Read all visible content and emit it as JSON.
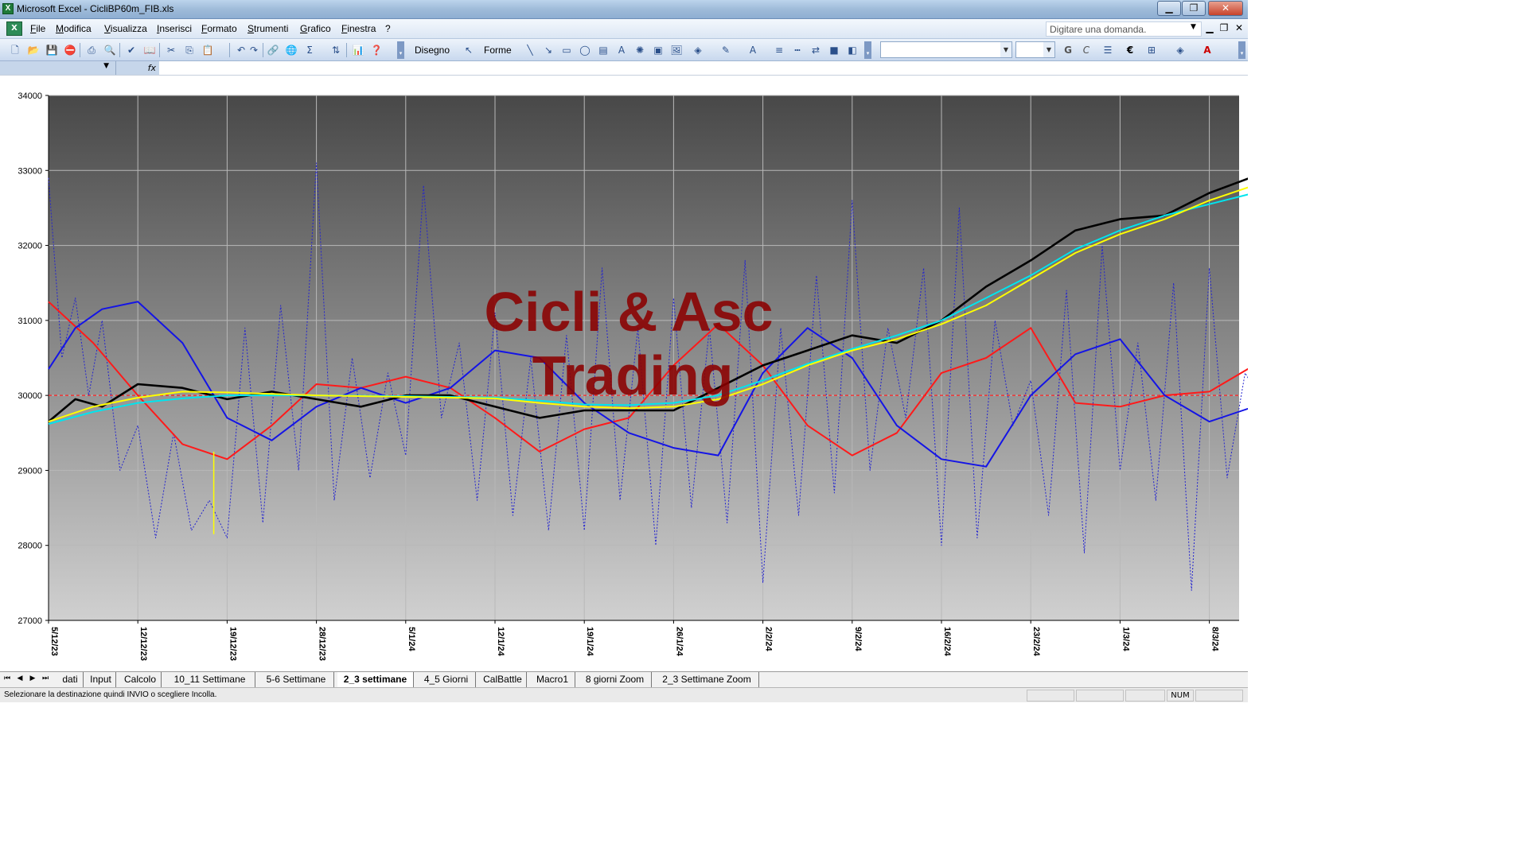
{
  "window": {
    "title": "Microsoft Excel - CicliBP60m_FIB.xls",
    "controls": {
      "minimize": "▁",
      "restore": "❐",
      "close": "✕"
    }
  },
  "menubar": {
    "items": [
      "File",
      "Modifica",
      "Visualizza",
      "Inserisci",
      "Formato",
      "Strumenti",
      "Grafico",
      "Finestra",
      "?"
    ],
    "help_placeholder": "Digitare una domanda.",
    "mdi": {
      "minimize": "▁",
      "restore": "❐",
      "close": "✕"
    }
  },
  "toolbar": {
    "disegno_label": "Disegno",
    "forme_label": "Forme",
    "icons": [
      "new-icon",
      "open-icon",
      "save-icon",
      "permission-icon",
      "print-icon",
      "print-preview-icon",
      "spelling-icon",
      "research-icon",
      "cut-icon",
      "copy-icon",
      "paste-icon",
      "undo-icon",
      "redo-icon",
      "insert-hyperlink-icon",
      "autosum-icon",
      "sort-icon",
      "chart-wizard-icon",
      "help-icon"
    ],
    "bold_label": "G",
    "italic_label": "C",
    "euro_label": "€",
    "font_color_label": "A"
  },
  "formula_bar": {
    "fx_label": "fx"
  },
  "chart_data": {
    "type": "line",
    "ylim": [
      27000,
      34000
    ],
    "yticks": [
      27000,
      28000,
      29000,
      30000,
      31000,
      32000,
      33000,
      34000
    ],
    "xtick_labels": [
      "5/12/23",
      "12/12/23",
      "19/12/23",
      "28/12/23",
      "5/1/24",
      "12/1/24",
      "19/1/24",
      "26/1/24",
      "2/2/24",
      "9/2/24",
      "16/2/24",
      "23/2/24",
      "1/3/24",
      "8/3/24"
    ],
    "reference_line": 30000,
    "watermark": [
      "Cicli & Asc",
      "Trading"
    ],
    "colors": {
      "price": "#000000",
      "yellow": "#ffff00",
      "cyan": "#00e5ee",
      "red": "#ff1a1a",
      "blue": "#1414e6",
      "dotted": "#2323d0",
      "watermark": "#8b0000"
    },
    "series": [
      {
        "key": "price",
        "x": [
          0,
          0.3,
          0.6,
          1,
          1.5,
          2,
          2.5,
          3,
          3.5,
          4,
          4.5,
          5,
          5.5,
          6,
          6.5,
          7,
          7.5,
          8,
          8.5,
          9,
          9.5,
          10,
          10.5,
          11,
          11.5,
          12,
          12.5,
          13,
          13.5,
          13.9
        ],
        "values": [
          29650,
          29950,
          29850,
          30150,
          30100,
          29950,
          30050,
          29950,
          29850,
          30000,
          30000,
          29850,
          29700,
          29800,
          29800,
          29800,
          30100,
          30400,
          30600,
          30800,
          30700,
          31000,
          31450,
          31800,
          32200,
          32350,
          32400,
          32700,
          32920,
          32750
        ]
      },
      {
        "key": "yellow",
        "x": [
          0,
          0.5,
          1,
          1.5,
          2,
          3,
          4,
          5,
          5.5,
          6,
          6.5,
          7,
          7.5,
          8,
          8.5,
          9,
          9.5,
          10,
          10.5,
          11,
          11.5,
          12,
          12.5,
          13,
          13.5,
          13.9
        ],
        "values": [
          29650,
          29850,
          29970,
          30050,
          30040,
          30000,
          29980,
          29960,
          29900,
          29850,
          29830,
          29850,
          29950,
          30150,
          30400,
          30600,
          30750,
          30950,
          31200,
          31550,
          31900,
          32150,
          32350,
          32600,
          32800,
          32900
        ]
      },
      {
        "key": "cyan",
        "x": [
          0,
          0.5,
          1,
          1.5,
          2,
          3,
          4,
          5,
          5.5,
          6,
          6.5,
          7,
          7.5,
          8,
          8.5,
          9,
          9.5,
          10,
          10.5,
          11,
          11.5,
          12,
          12.5,
          13,
          13.5,
          13.9
        ],
        "values": [
          29620,
          29780,
          29900,
          29960,
          30000,
          30000,
          29990,
          29970,
          29930,
          29880,
          29870,
          29900,
          30000,
          30200,
          30420,
          30620,
          30800,
          31000,
          31300,
          31600,
          31950,
          32200,
          32400,
          32550,
          32700,
          32800
        ]
      },
      {
        "key": "red",
        "x": [
          0,
          0.5,
          1,
          1.5,
          2,
          2.5,
          3,
          3.5,
          4,
          4.5,
          5,
          5.5,
          6,
          6.5,
          7,
          7.5,
          8,
          8.5,
          9,
          9.5,
          10,
          10.5,
          11,
          11.5,
          12,
          12.5,
          13,
          13.5,
          13.9
        ],
        "values": [
          31250,
          30700,
          30000,
          29350,
          29150,
          29600,
          30150,
          30100,
          30250,
          30100,
          29700,
          29250,
          29550,
          29700,
          30400,
          30950,
          30400,
          29600,
          29200,
          29500,
          30300,
          30500,
          30900,
          29900,
          29850,
          30000,
          30050,
          30400,
          29950
        ]
      },
      {
        "key": "blue",
        "x": [
          0,
          0.3,
          0.6,
          1,
          1.5,
          2,
          2.5,
          3,
          3.5,
          4,
          4.5,
          5,
          5.5,
          6,
          6.5,
          7,
          7.5,
          8,
          8.5,
          9,
          9.5,
          10,
          10.5,
          11,
          11.5,
          12,
          12.5,
          13,
          13.5,
          13.9
        ],
        "values": [
          30350,
          30900,
          31150,
          31250,
          30700,
          29700,
          29400,
          29850,
          30100,
          29900,
          30100,
          30600,
          30500,
          29900,
          29500,
          29300,
          29200,
          30300,
          30900,
          30500,
          29600,
          29150,
          29050,
          30000,
          30550,
          30750,
          30000,
          29650,
          29850,
          30500
        ]
      },
      {
        "key": "dotted",
        "x": [
          0,
          0.15,
          0.3,
          0.45,
          0.6,
          0.8,
          1,
          1.2,
          1.4,
          1.6,
          1.8,
          2,
          2.2,
          2.4,
          2.6,
          2.8,
          3,
          3.2,
          3.4,
          3.6,
          3.8,
          4,
          4.2,
          4.4,
          4.6,
          4.8,
          5,
          5.2,
          5.4,
          5.6,
          5.8,
          6,
          6.2,
          6.4,
          6.6,
          6.8,
          7,
          7.2,
          7.4,
          7.6,
          7.8,
          8,
          8.2,
          8.4,
          8.6,
          8.8,
          9,
          9.2,
          9.4,
          9.6,
          9.8,
          10,
          10.2,
          10.4,
          10.6,
          10.8,
          11,
          11.2,
          11.4,
          11.6,
          11.8,
          12,
          12.2,
          12.4,
          12.6,
          12.8,
          13,
          13.2,
          13.4,
          13.6,
          13.8,
          13.9
        ],
        "values": [
          32900,
          30500,
          31300,
          30000,
          31000,
          29000,
          29600,
          28100,
          29500,
          28200,
          28600,
          28100,
          30900,
          28300,
          31200,
          29000,
          33100,
          28600,
          30500,
          28900,
          30300,
          29200,
          32800,
          29700,
          30700,
          28600,
          31100,
          28400,
          30500,
          28200,
          30800,
          28200,
          31700,
          28600,
          30900,
          28000,
          31300,
          28500,
          30900,
          28300,
          31800,
          27500,
          30900,
          28400,
          31600,
          28700,
          32600,
          29000,
          30900,
          29700,
          31700,
          28000,
          32500,
          28100,
          31000,
          29600,
          30200,
          28400,
          31400,
          27900,
          32000,
          29000,
          30700,
          28600,
          31500,
          27400,
          31700,
          28900,
          30300,
          29900,
          30000,
          28700
        ]
      },
      {
        "key": "marker_yellow_vertical",
        "x": [
          1.85,
          1.85
        ],
        "values": [
          29250,
          28150
        ]
      }
    ]
  },
  "sheet_tabs": {
    "nav": [
      "⏮",
      "◀",
      "▶",
      "⏭"
    ],
    "tabs": [
      "dati",
      "Input",
      "Calcolo",
      "10_11 Settimane",
      "5-6 Settimane",
      "2_3 settimane",
      "4_5 Giorni",
      "CalBattle",
      "Macro1",
      "8 giorni Zoom",
      "2_3 Settimane Zoom"
    ],
    "active": "2_3 settimane"
  },
  "statusbar": {
    "message": "Selezionare la destinazione quindi INVIO o scegliere Incolla.",
    "num": "NUM"
  }
}
